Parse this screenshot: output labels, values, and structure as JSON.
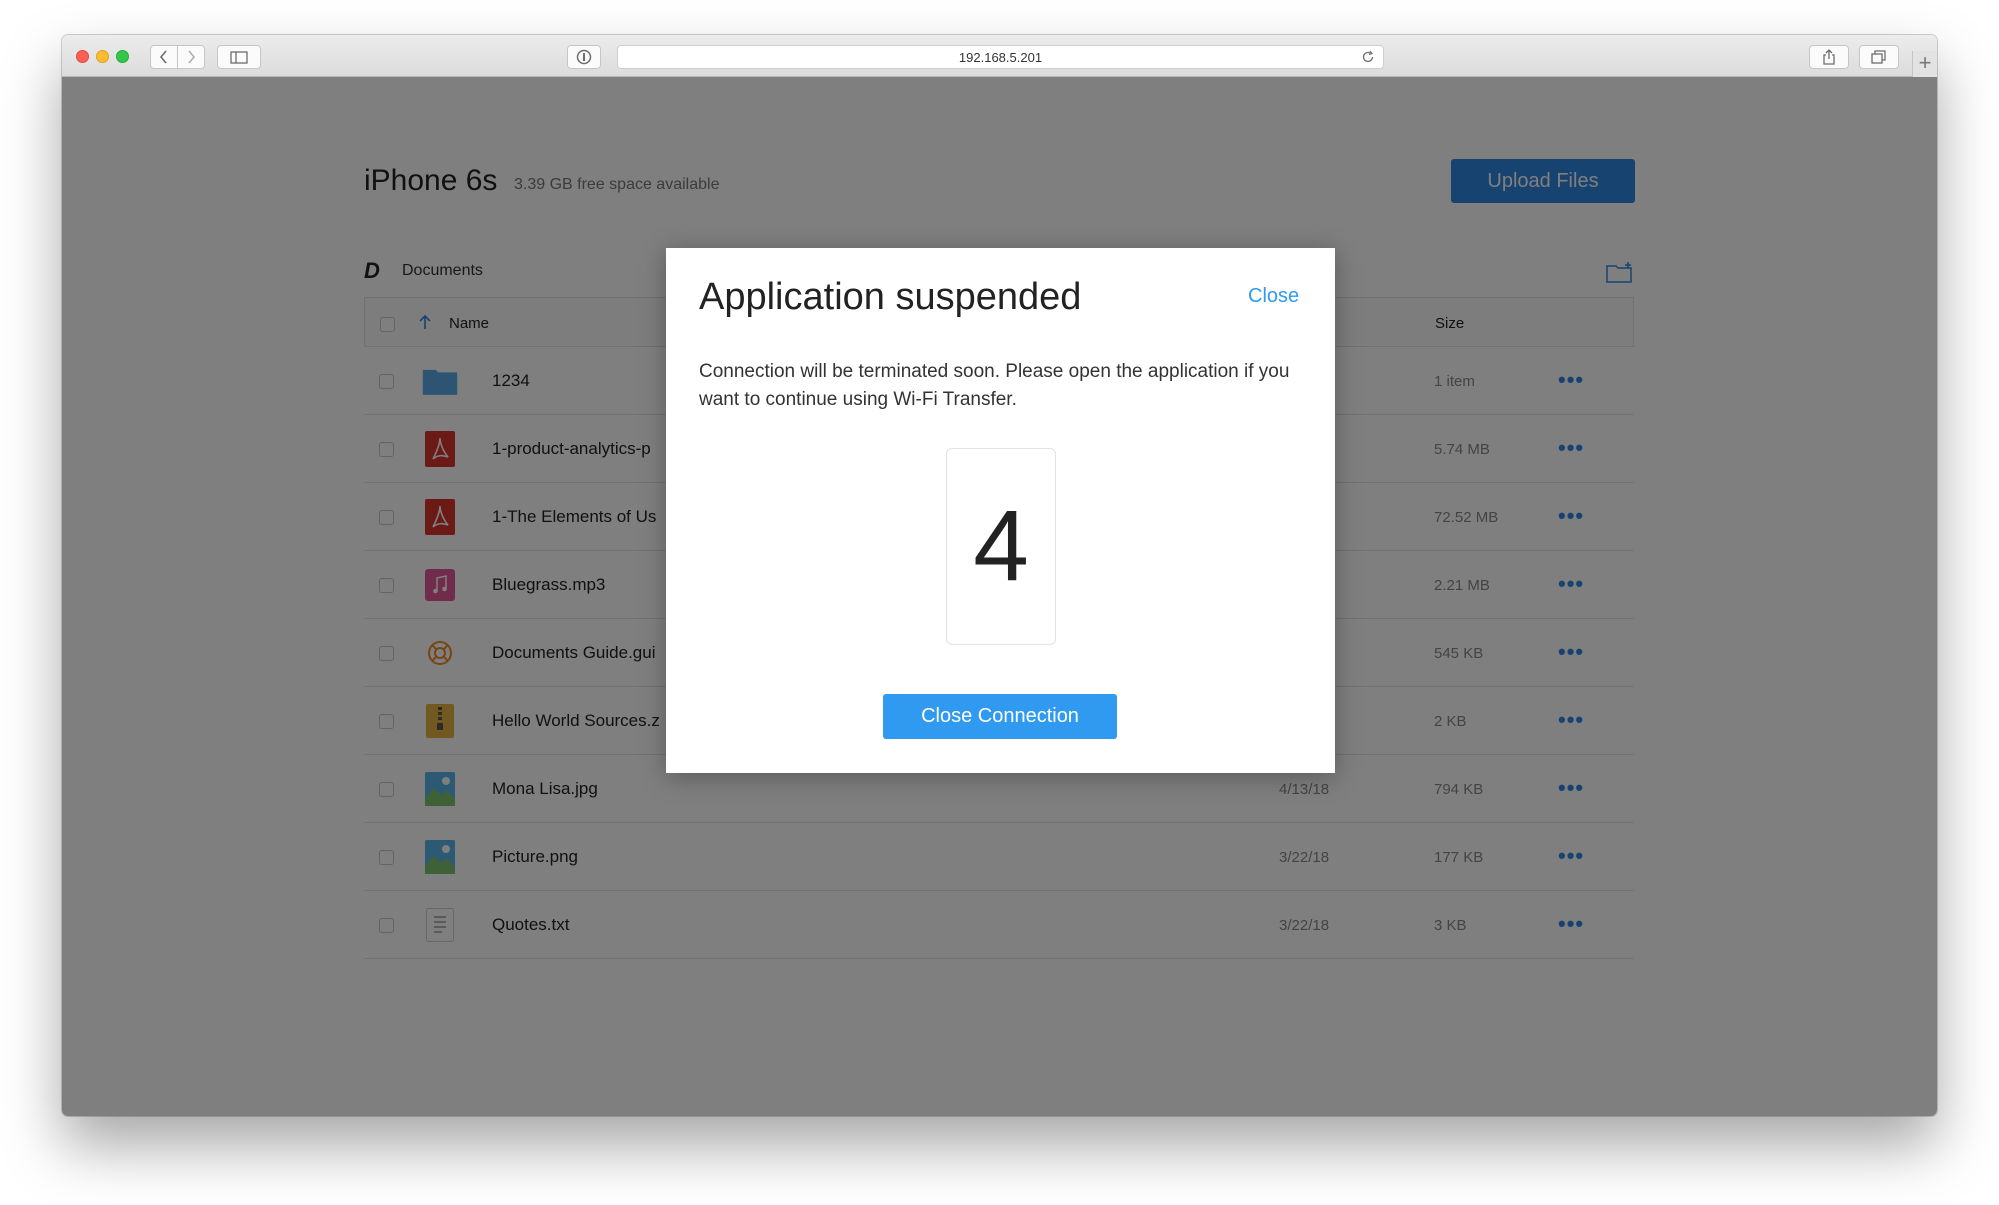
{
  "browser": {
    "url": "192.168.5.201"
  },
  "header": {
    "device_name": "iPhone 6s",
    "free_space": "3.39 GB free space available",
    "upload_label": "Upload Files"
  },
  "breadcrumb": {
    "logo": "D",
    "label": "Documents"
  },
  "table": {
    "columns": {
      "name": "Name",
      "size": "Size"
    },
    "rows": [
      {
        "name": "1234",
        "date": "",
        "size": "1 item",
        "icon": "folder-icon",
        "color": "#5aa9e6"
      },
      {
        "name": "1-product-analytics-p",
        "date": "",
        "size": "5.74 MB",
        "icon": "pdf-icon",
        "color": "#d9342b"
      },
      {
        "name": "1-The Elements of Us",
        "date": "",
        "size": "72.52 MB",
        "icon": "pdf-icon",
        "color": "#d9342b"
      },
      {
        "name": "Bluegrass.mp3",
        "date": "",
        "size": "2.21 MB",
        "icon": "music-icon",
        "color": "#e35797"
      },
      {
        "name": "Documents Guide.gui",
        "date": "",
        "size": "545 KB",
        "icon": "lifebuoy-icon",
        "color": "#f08c2a"
      },
      {
        "name": "Hello World Sources.z",
        "date": "",
        "size": "2 KB",
        "icon": "zip-icon",
        "color": "#e3b341"
      },
      {
        "name": "Mona Lisa.jpg",
        "date": "4/13/18",
        "size": "794 KB",
        "icon": "image-icon",
        "color": "#58b4e8"
      },
      {
        "name": "Picture.png",
        "date": "3/22/18",
        "size": "177 KB",
        "icon": "image-icon",
        "color": "#58b4e8"
      },
      {
        "name": "Quotes.txt",
        "date": "3/22/18",
        "size": "3 KB",
        "icon": "text-file-icon",
        "color": "#9a9a9a"
      }
    ],
    "more_label": "•••"
  },
  "modal": {
    "title": "Application suspended",
    "close_label": "Close",
    "message": "Connection will be terminated soon. Please open the application if you want to continue using Wi-Fi Transfer.",
    "countdown": "4",
    "button_label": "Close Connection"
  },
  "colors": {
    "accent": "#2f86e3",
    "modal_accent": "#2f9aef"
  }
}
